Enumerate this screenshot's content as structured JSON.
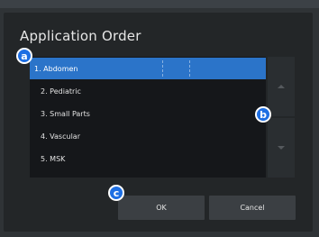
{
  "dialog": {
    "title": "Application Order"
  },
  "list": {
    "items": [
      {
        "label": "1. Abdomen",
        "selected": true
      },
      {
        "label": "2. Pediatric",
        "selected": false
      },
      {
        "label": "3. Small Parts",
        "selected": false
      },
      {
        "label": "4. Vascular",
        "selected": false
      },
      {
        "label": "5. MSK",
        "selected": false
      }
    ]
  },
  "buttons": {
    "ok_label": "OK",
    "cancel_label": "Cancel",
    "move_up_icon": "triangle-up-icon",
    "move_down_icon": "triangle-down-icon"
  },
  "callouts": {
    "a": "a",
    "b": "b",
    "c": "c"
  },
  "colors": {
    "selection": "#2b74c9",
    "callout": "#1e6fe3"
  }
}
